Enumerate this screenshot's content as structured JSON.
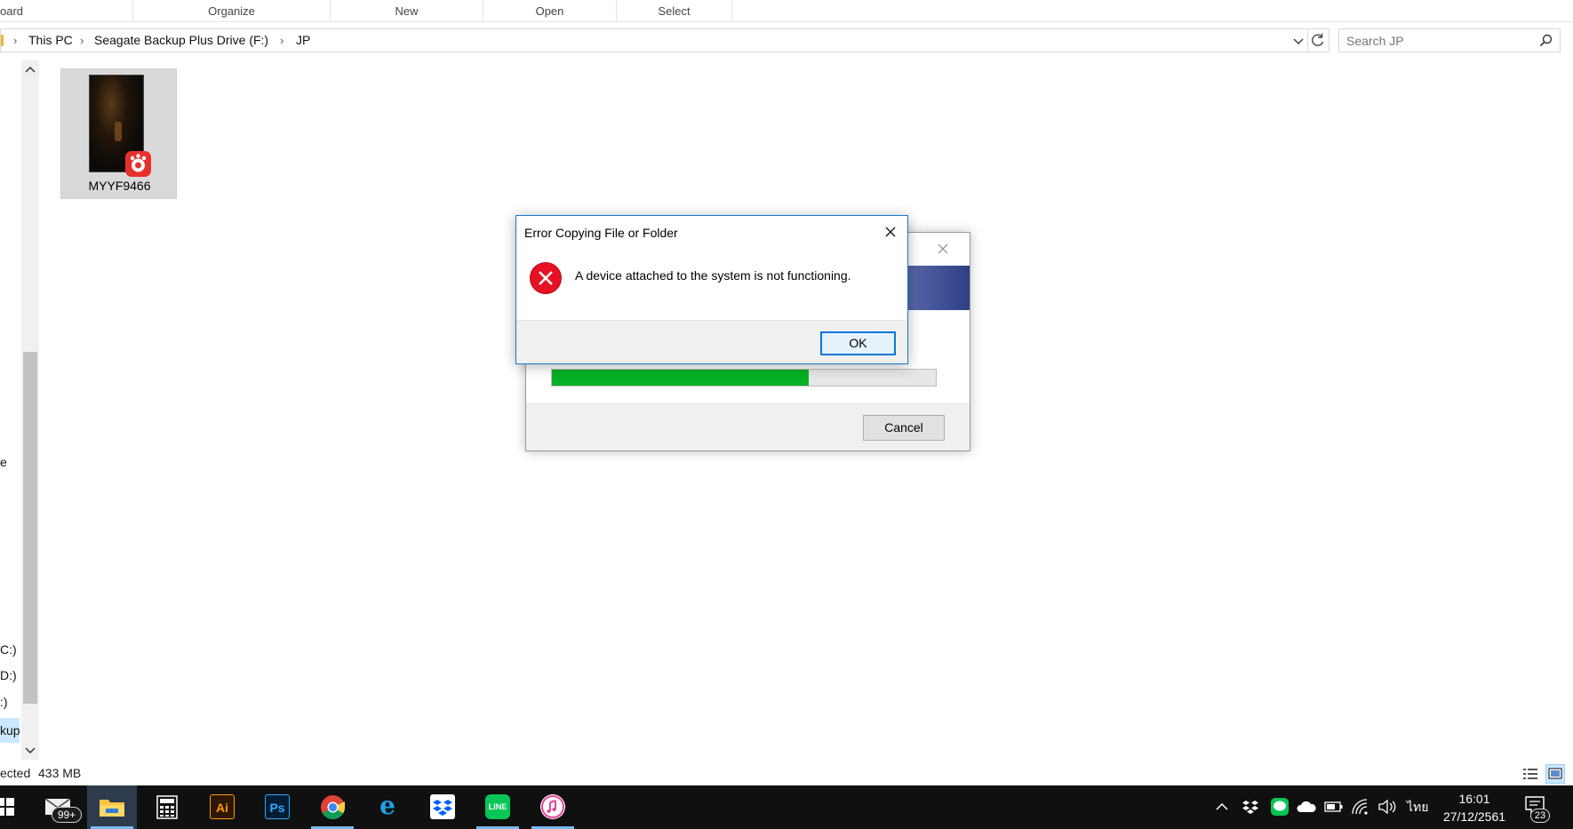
{
  "ribbon": {
    "groups": [
      "oard",
      "Organize",
      "New",
      "Open",
      "Select"
    ]
  },
  "address": {
    "segments": [
      "This PC",
      "Seagate Backup Plus Drive (F:)",
      "JP"
    ]
  },
  "search": {
    "placeholder": "Search JP"
  },
  "nav": {
    "items": [
      "e",
      "C:)",
      "D:)",
      ":)",
      "kup"
    ]
  },
  "file": {
    "name": "MYYF9466"
  },
  "copy_dialog": {
    "cancel_label": "Cancel",
    "progress_fraction": 0.67
  },
  "error_dialog": {
    "title": "Error Copying File or Folder",
    "message": "A device attached to the system is not functioning.",
    "ok_label": "OK"
  },
  "status": {
    "selected_text": "ected",
    "size_text": "433 MB"
  },
  "taskbar": {
    "mail_badge": "99+",
    "apps": [
      "start-icon",
      "mail-icon",
      "file-explorer-icon",
      "calculator-icon",
      "illustrator-icon",
      "photoshop-icon",
      "chrome-icon",
      "edge-icon",
      "dropbox-icon",
      "line-icon",
      "itunes-icon"
    ],
    "illustrator_label": "Ai",
    "photoshop_label": "Ps",
    "line_label": "LINE",
    "language": "ไทย",
    "time": "16:01",
    "date": "27/12/2561",
    "notification_count": "23"
  },
  "colors": {
    "progress": "#06b025",
    "accent": "#0078d7",
    "error": "#e81123",
    "taskbar": "#101010"
  }
}
